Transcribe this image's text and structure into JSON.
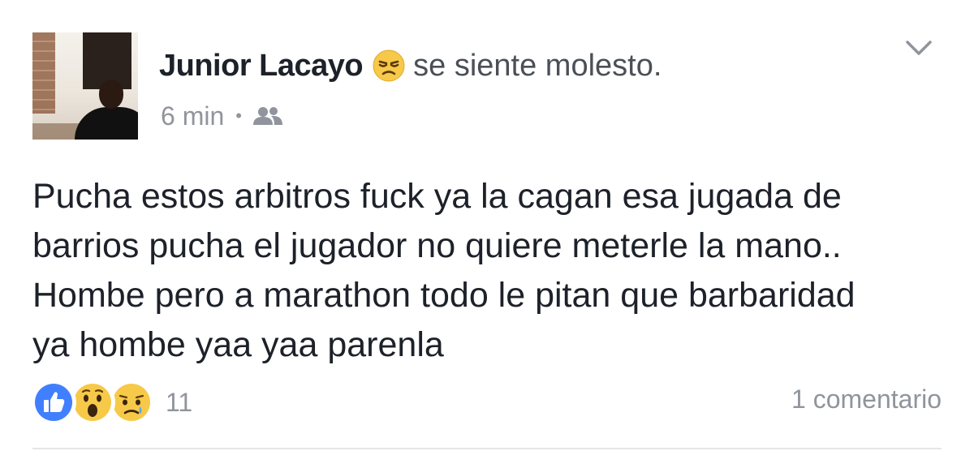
{
  "post": {
    "author": "Junior Lacayo",
    "feeling": "se siente molesto.",
    "feeling_icon": "annoyed-face-icon",
    "time": "6 min",
    "separator": "•",
    "audience_icon": "friends-icon",
    "text_lines": [
      "Pucha estos arbitros fuck ya la cagan esa jugada de",
      "barrios pucha el jugador no quiere meterle la mano..",
      "Hombe pero a marathon todo le pitan que barbaridad",
      "ya hombe yaa yaa parenla"
    ],
    "reaction_icons": [
      "like-icon",
      "wow-icon",
      "sad-icon"
    ],
    "reaction_count": "11",
    "comments": "1 comentario"
  },
  "colors": {
    "primary_text": "#1d2129",
    "secondary_text": "#90949c",
    "feeling_text": "#4b4f56",
    "like_blue": "#4080ff",
    "emoji_yellow": "#fcd34d"
  }
}
